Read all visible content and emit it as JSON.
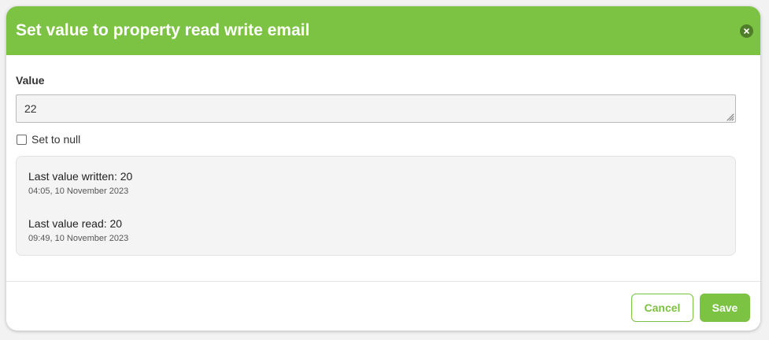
{
  "dialog": {
    "title": "Set value to property read write email"
  },
  "value_field": {
    "label": "Value",
    "value": "22"
  },
  "null_option": {
    "label": "Set to null",
    "checked": false
  },
  "history": {
    "last_written_label": "Last value written: 20",
    "last_written_time": "04:05, 10 November 2023",
    "last_read_label": "Last value read: 20",
    "last_read_time": "09:49, 10 November 2023"
  },
  "footer": {
    "cancel_label": "Cancel",
    "save_label": "Save"
  },
  "colors": {
    "accent": "#7cc243",
    "close_bg": "#4f7d2a"
  },
  "icons": {
    "close": "close-icon",
    "resize": "resize-grip-icon"
  }
}
